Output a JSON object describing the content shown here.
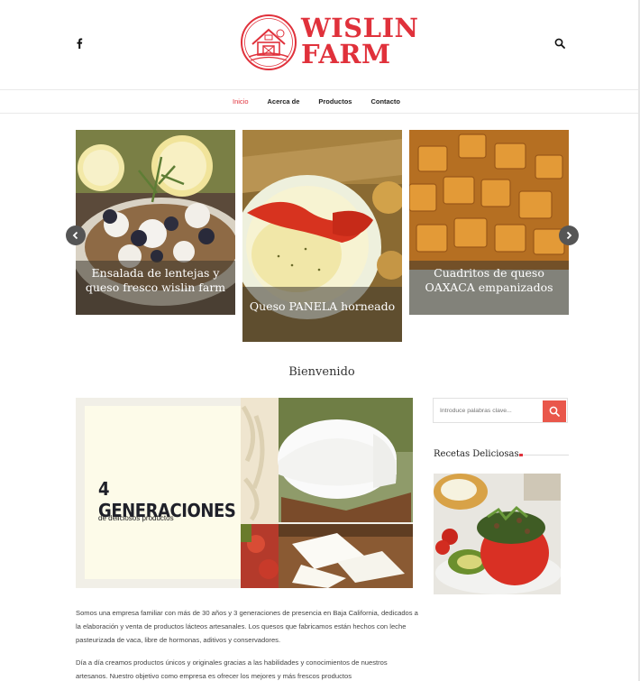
{
  "brand": {
    "line1": "WISLIN",
    "line2": "FARM",
    "color": "#e0313b"
  },
  "header": {
    "social_icon": "facebook-icon",
    "search_icon": "search-icon"
  },
  "nav": {
    "items": [
      {
        "label": "Inicio",
        "active": true
      },
      {
        "label": "Acerca de",
        "active": false
      },
      {
        "label": "Productos",
        "active": false
      },
      {
        "label": "Contacto",
        "active": false
      }
    ]
  },
  "slider": {
    "slides": [
      {
        "caption": "Ensalada de lentejas y queso fresco wislin farm"
      },
      {
        "caption": "Queso PANELA horneado"
      },
      {
        "caption": "Cuadritos de queso OAXACA empanizados"
      }
    ],
    "prev_icon": "chevron-left-icon",
    "next_icon": "chevron-right-icon"
  },
  "welcome": {
    "title": "Bienvenido"
  },
  "hero": {
    "title": "4 GENERACIONES",
    "subtitle": "de deliciosos productos"
  },
  "body": {
    "paragraphs": [
      "Somos una empresa familiar con más de 30 años y 3 generaciones de presencia en Baja California, dedicados a la elaboración y venta de productos lácteos artesanales. Los quesos que fabricamos están hechos con leche pasteurizada de vaca, libre de hormonas, aditivos y conservadores.",
      "Día a día creamos productos únicos y originales gracias a las habilidades y conocimientos de nuestros artesanos. Nuestro objetivo como empresa es ofrecer los mejores y más frescos productos"
    ]
  },
  "sidebar": {
    "search_placeholder": "Introduce palabras clave...",
    "section_title": "Recetas Deliciosas",
    "accent": "#e9574b"
  }
}
